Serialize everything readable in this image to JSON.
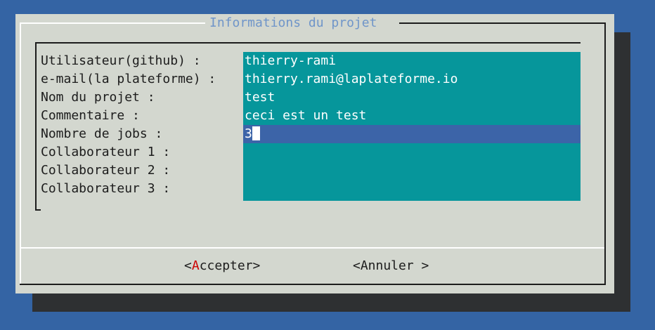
{
  "dialog": {
    "title": "Informations du projet"
  },
  "form": {
    "fields": [
      {
        "label": "Utilisateur(github) :",
        "value": "thierry-rami"
      },
      {
        "label": "e-mail(la plateforme) :",
        "value": "thierry.rami@laplateforme.io"
      },
      {
        "label": "Nom du projet :",
        "value": "test"
      },
      {
        "label": "Commentaire :",
        "value": "ceci est un test"
      },
      {
        "label": "Nombre de jobs :",
        "value": "3"
      },
      {
        "label": "Collaborateur 1 :",
        "value": ""
      },
      {
        "label": "Collaborateur 2 :",
        "value": ""
      },
      {
        "label": "Collaborateur 3 :",
        "value": ""
      }
    ],
    "active_field_index": 4
  },
  "buttons": {
    "accept": {
      "open": "<",
      "hotkey": "A",
      "rest": "ccepter>"
    },
    "cancel": {
      "label": "<Annuler >"
    }
  },
  "colors": {
    "background": "#3464a4",
    "dialog": "#d3d7cf",
    "field": "#06969b",
    "active_field": "#3c64a8",
    "title": "#6f95c9",
    "hotkey": "#cc0000"
  }
}
